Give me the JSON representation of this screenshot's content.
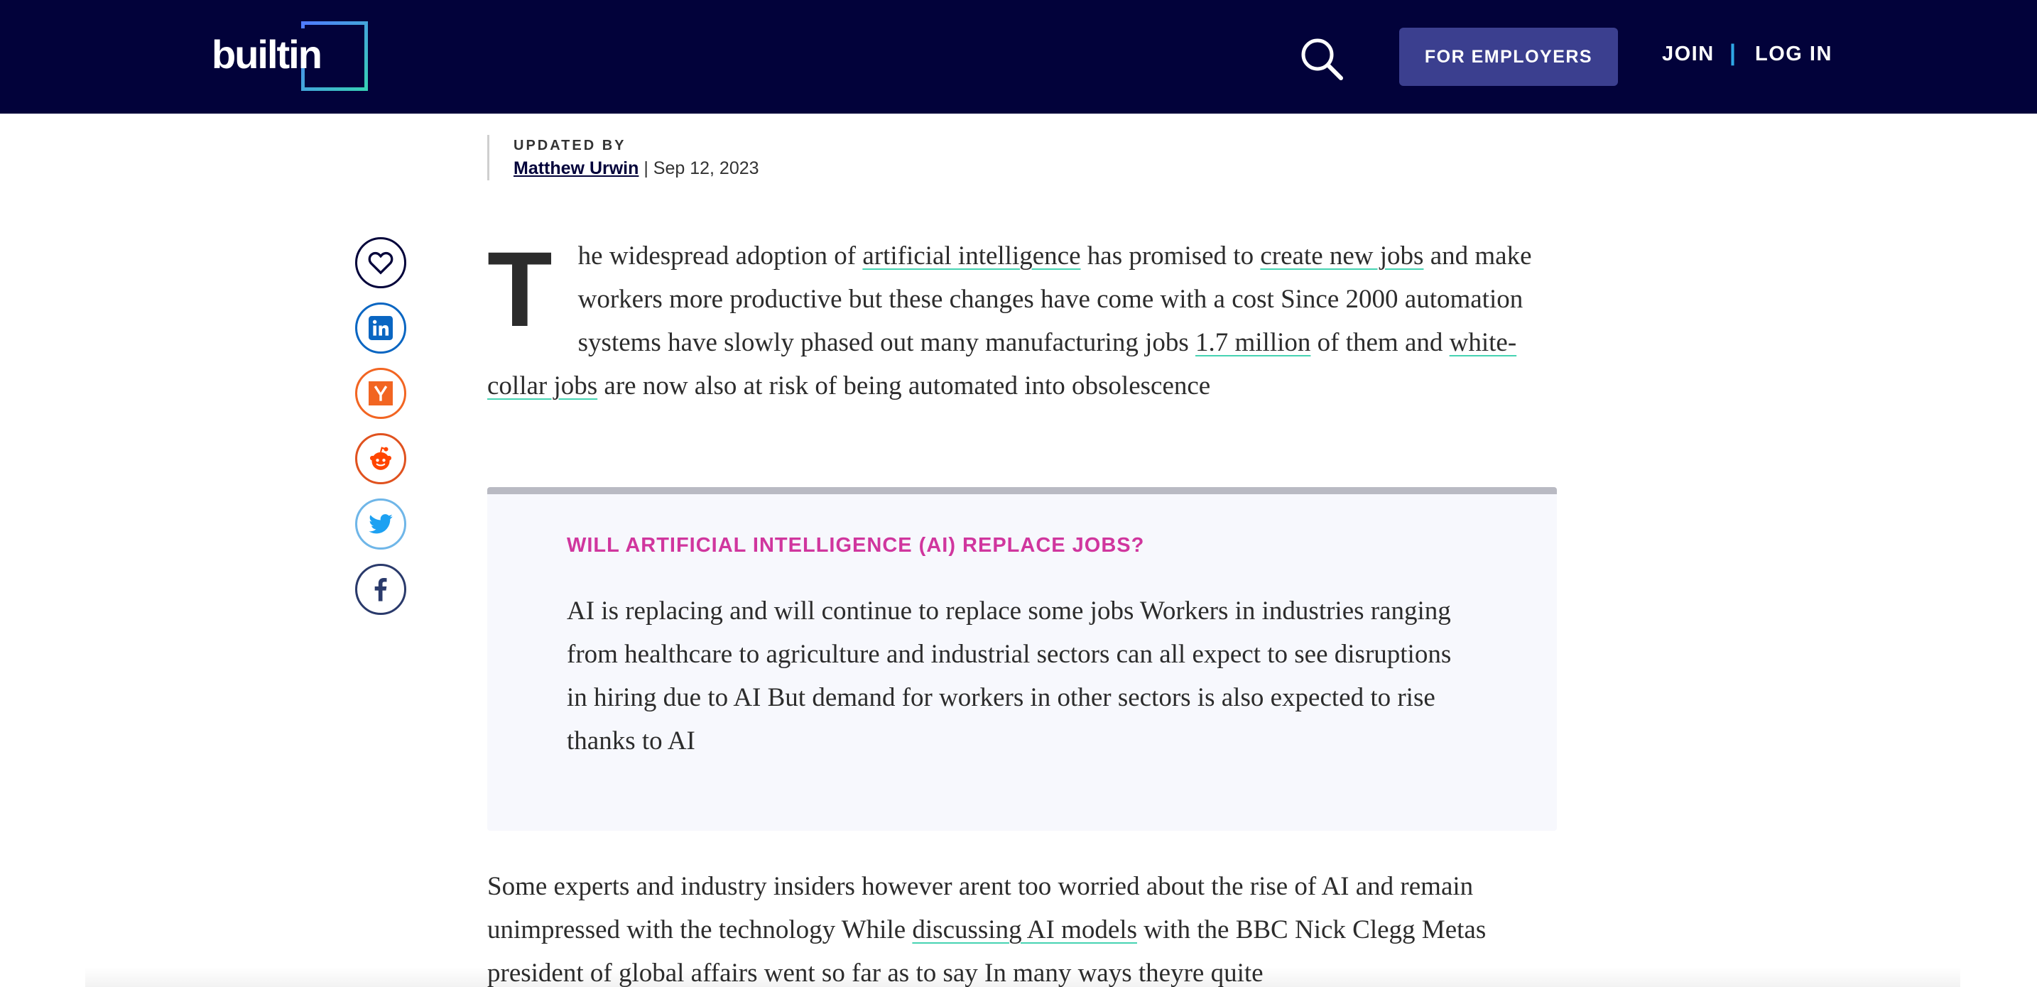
{
  "header": {
    "logo_text": "builtin",
    "employers_label": "FOR EMPLOYERS",
    "join_label": "JOIN",
    "separator": "|",
    "login_label": "LOG IN",
    "background": "#02023a"
  },
  "byline": {
    "label": "UPDATED BY",
    "author": "Matthew Urwin",
    "date_separator": " | ",
    "date": "Sep 12, 2023"
  },
  "share": {
    "icons": [
      "heart-icon",
      "linkedin-icon",
      "hacker-news-icon",
      "reddit-icon",
      "twitter-icon",
      "facebook-icon"
    ],
    "colors": {
      "heart": "#02023a",
      "linkedin": "#0a66c2",
      "hacker_news": "#f26522",
      "reddit": "#ff4500",
      "twitter": "#1da1f2",
      "facebook": "#3b5998"
    }
  },
  "article": {
    "dropcap": "T",
    "p1": [
      {
        "t": "he widespread adoption of "
      },
      {
        "t": "artificial intelligence",
        "link": true
      },
      {
        "t": " has promised to "
      },
      {
        "t": "create new jobs",
        "link": true
      },
      {
        "t": " and make workers more productive but these changes have come with a cost Since 2000 automation systems have slowly phased out many manufacturing jobs "
      },
      {
        "t": "1.7 million",
        "link": true
      },
      {
        "t": " of them and "
      },
      {
        "t": "white-collar jobs",
        "link": true
      },
      {
        "t": " are now also at risk of being automated into obsolescence"
      }
    ],
    "callout_title": "WILL ARTIFICIAL INTELLIGENCE (AI) REPLACE JOBS?",
    "callout_text": "AI is replacing and will continue to replace some jobs Workers in industries ranging from healthcare to agriculture and industrial sectors can all expect to see disruptions in hiring due to AI But demand for workers in other sectors is also expected to rise thanks to AI",
    "p2": [
      {
        "t": "Some experts and industry insiders however arent too worried about the rise of AI and remain unimpressed with the technology While "
      },
      {
        "t": "discussing AI models",
        "link": true
      },
      {
        "t": " with the BBC Nick Clegg Metas president of global affairs went so far as to say In many ways theyre quite"
      }
    ]
  },
  "colors": {
    "link_underline": "#46d3b2",
    "callout_title": "#d0369e",
    "callout_bg": "#f7f8fd",
    "employers_btn": "#3b3f8f"
  }
}
